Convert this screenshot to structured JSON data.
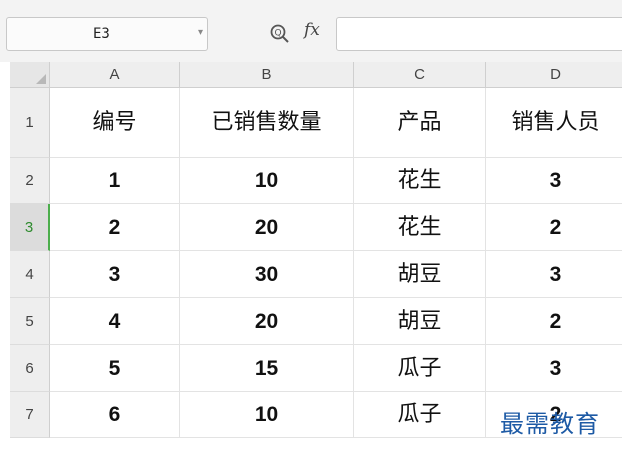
{
  "name_box": {
    "value": "E3"
  },
  "formula_bar": {
    "fx_label": "fx",
    "value": ""
  },
  "columns": [
    "A",
    "B",
    "C",
    "D"
  ],
  "rows": [
    {
      "num": "1",
      "cells": [
        "编号",
        "已销售数量",
        "产品",
        "销售人员"
      ]
    },
    {
      "num": "2",
      "cells": [
        "1",
        "10",
        "花生",
        "3"
      ]
    },
    {
      "num": "3",
      "cells": [
        "2",
        "20",
        "花生",
        "2"
      ]
    },
    {
      "num": "4",
      "cells": [
        "3",
        "30",
        "胡豆",
        "3"
      ]
    },
    {
      "num": "5",
      "cells": [
        "4",
        "20",
        "胡豆",
        "2"
      ]
    },
    {
      "num": "6",
      "cells": [
        "5",
        "15",
        "瓜子",
        "3"
      ]
    },
    {
      "num": "7",
      "cells": [
        "6",
        "10",
        "瓜子",
        "2"
      ]
    }
  ],
  "active_row": "3",
  "watermark": "最需教育",
  "colors": {
    "accent": "#4cae4c",
    "watermark": "#1d5aa5"
  }
}
